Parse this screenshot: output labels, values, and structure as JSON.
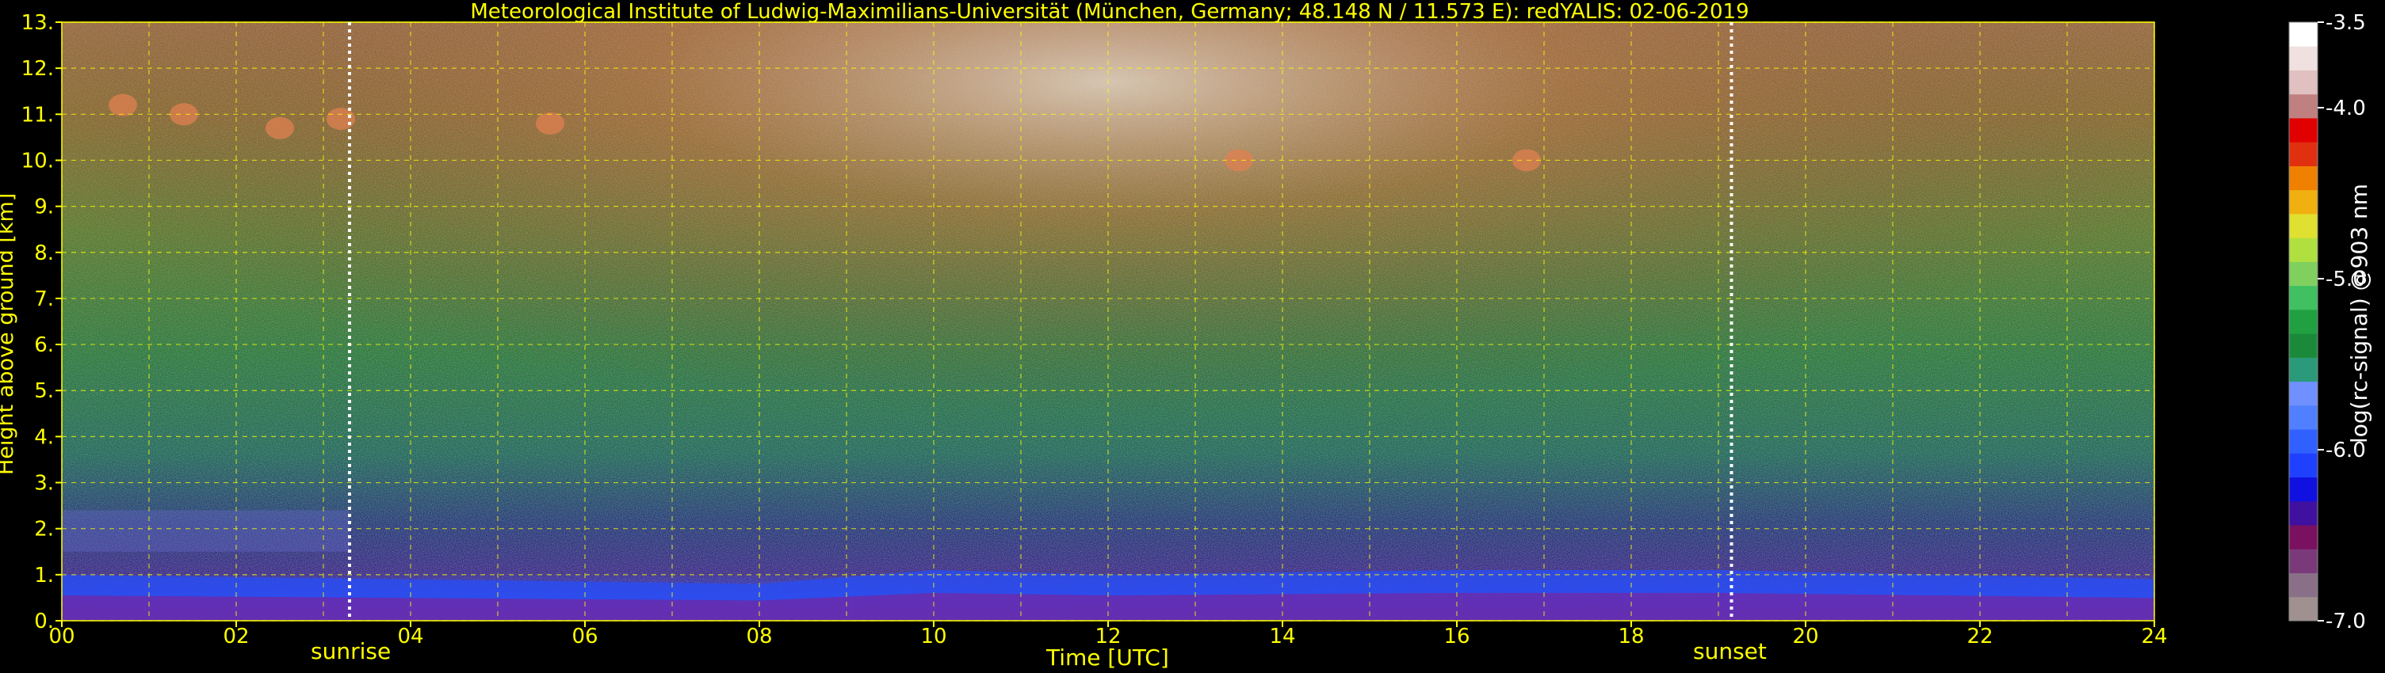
{
  "chart_data": {
    "type": "heatmap",
    "title": "Meteorological Institute of Ludwig-Maximilians-Universität (München, Germany; 48.148 N / 11.573 E):    redYALIS: 02-06-2019",
    "xlabel": "Time [UTC]",
    "ylabel": "Height above ground [km]",
    "xlim": [
      0,
      24
    ],
    "ylim": [
      0,
      13
    ],
    "x_ticks": [
      "00",
      "02",
      "04",
      "06",
      "08",
      "10",
      "12",
      "14",
      "16",
      "18",
      "20",
      "22",
      "24"
    ],
    "y_ticks": [
      "0.",
      "1.",
      "2.",
      "3.",
      "4.",
      "5.",
      "6.",
      "7.",
      "8.",
      "9.",
      "10.",
      "11.",
      "12.",
      "13."
    ],
    "grid": true,
    "markers": [
      {
        "label": "sunrise",
        "time": 3.3
      },
      {
        "label": "sunset",
        "time": 19.15
      }
    ],
    "colorbar": {
      "label": "log(rc-signal) @903 nm",
      "ticks": [
        "-3.5",
        "-4.0",
        "-5.0",
        "-6.0",
        "-7.0"
      ],
      "tick_values": [
        -3.5,
        -4.0,
        -5.0,
        -6.0,
        -7.0
      ],
      "range": [
        -7.0,
        -3.5
      ],
      "colors": [
        "#a09090",
        "#8a6f88",
        "#7a3a7a",
        "#7a1060",
        "#4010a0",
        "#1010e0",
        "#2040ff",
        "#3060ff",
        "#5080ff",
        "#7090ff",
        "#2a9a7a",
        "#1a8a3a",
        "#20a040",
        "#40c060",
        "#80d060",
        "#b0e040",
        "#e0e030",
        "#f0b010",
        "#f08000",
        "#e03010",
        "#e00000",
        "#c08080",
        "#e0c0c0",
        "#f0e0e0",
        "#ffffff"
      ]
    },
    "aerosol_layer_top_km": [
      {
        "time": 0,
        "top": 1.0
      },
      {
        "time": 4,
        "top": 0.9
      },
      {
        "time": 8,
        "top": 0.8
      },
      {
        "time": 10,
        "top": 1.1
      },
      {
        "time": 12,
        "top": 1.0
      },
      {
        "time": 16,
        "top": 1.1
      },
      {
        "time": 19,
        "top": 1.1
      },
      {
        "time": 24,
        "top": 0.9
      }
    ],
    "cloud_patches": [
      {
        "time": 0.7,
        "height": 11.2
      },
      {
        "time": 1.4,
        "height": 11.0
      },
      {
        "time": 2.5,
        "height": 10.7
      },
      {
        "time": 3.2,
        "height": 10.9
      },
      {
        "time": 5.6,
        "height": 10.8
      },
      {
        "time": 13.5,
        "height": 10.0
      },
      {
        "time": 16.8,
        "height": 10.0
      }
    ]
  }
}
